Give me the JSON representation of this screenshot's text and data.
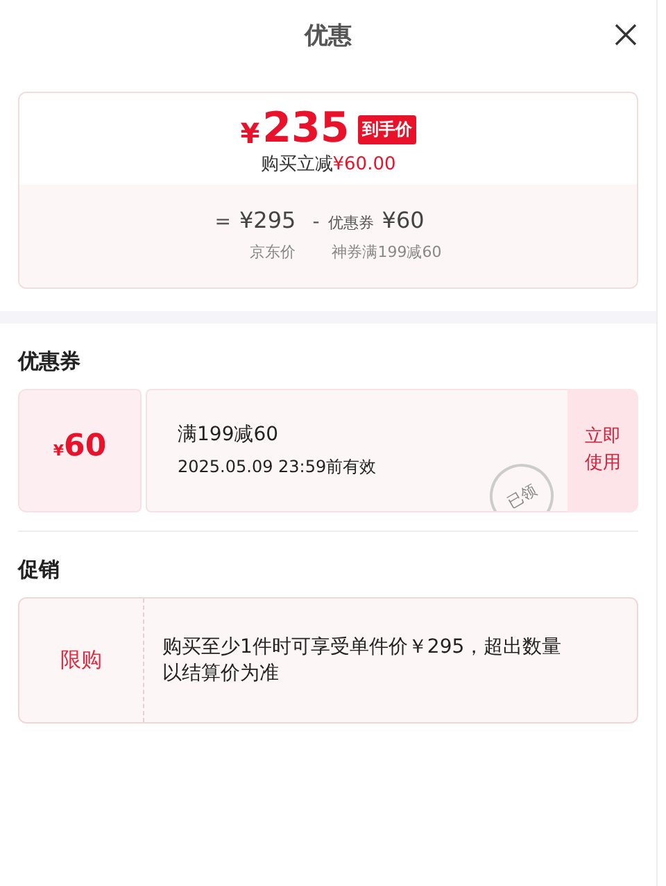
{
  "header": {
    "title": "优惠"
  },
  "price_card": {
    "currency": "¥",
    "amount": "235",
    "badge": "到手价",
    "savings_label": "购买立减",
    "savings_amount": "¥60.00",
    "breakdown": {
      "equals": "=",
      "base_price": "¥295",
      "minus": "-",
      "coupon_label": "优惠券",
      "coupon_value": "¥60",
      "base_caption": "京东价",
      "coupon_caption": "神券满199减60"
    }
  },
  "coupons": {
    "title": "优惠券",
    "items": [
      {
        "currency": "¥",
        "amount": "60",
        "condition": "满199减60",
        "validity": "2025.05.09 23:59前有效",
        "stamp": "已领",
        "action": "立即使用"
      }
    ]
  },
  "promotions": {
    "title": "促销",
    "items": [
      {
        "tag": "限购",
        "text": "购买至少1件时可享受单件价￥295，超出数量以结算价为准"
      }
    ]
  }
}
